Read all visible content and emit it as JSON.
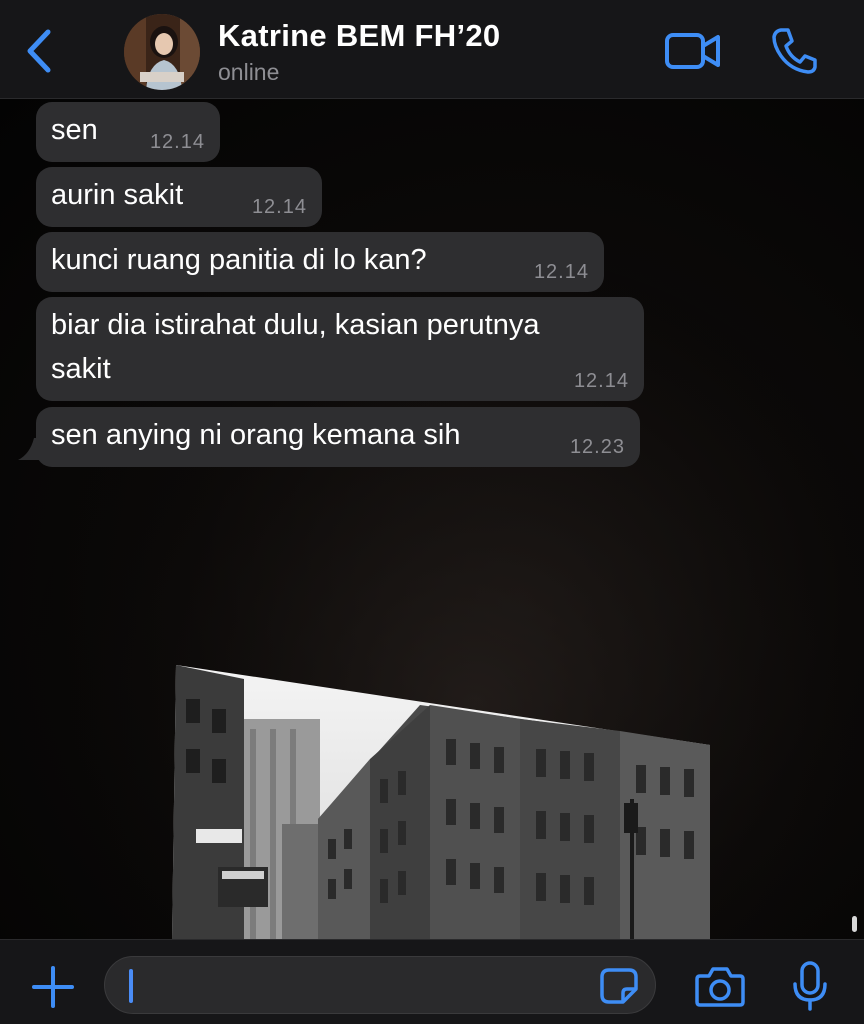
{
  "header": {
    "back_icon": "chevron-left-icon",
    "contact_name": "Katrine BEM FH’20",
    "status": "online",
    "video_icon": "video-camera-icon",
    "call_icon": "phone-icon",
    "accent_color": "#3e8df5"
  },
  "messages": [
    {
      "text": "sen",
      "time": "12.14"
    },
    {
      "text": "aurin sakit",
      "time": "12.14"
    },
    {
      "text": "kunci ruang panitia di lo kan?",
      "time": "12.14"
    },
    {
      "text": "biar dia istirahat dulu, kasian perutnya",
      "text_line2": "sakit",
      "time": "12.14"
    },
    {
      "text": "sen anying ni orang kemana sih",
      "time": "12.23"
    }
  ],
  "composer": {
    "plus_icon": "plus-icon",
    "input_value": "",
    "sticker_icon": "sticker-icon",
    "camera_icon": "camera-icon",
    "mic_icon": "microphone-icon"
  },
  "colors": {
    "bubble": "#2e2e30",
    "bar": "#161618",
    "timestamp": "#8e8e93"
  }
}
